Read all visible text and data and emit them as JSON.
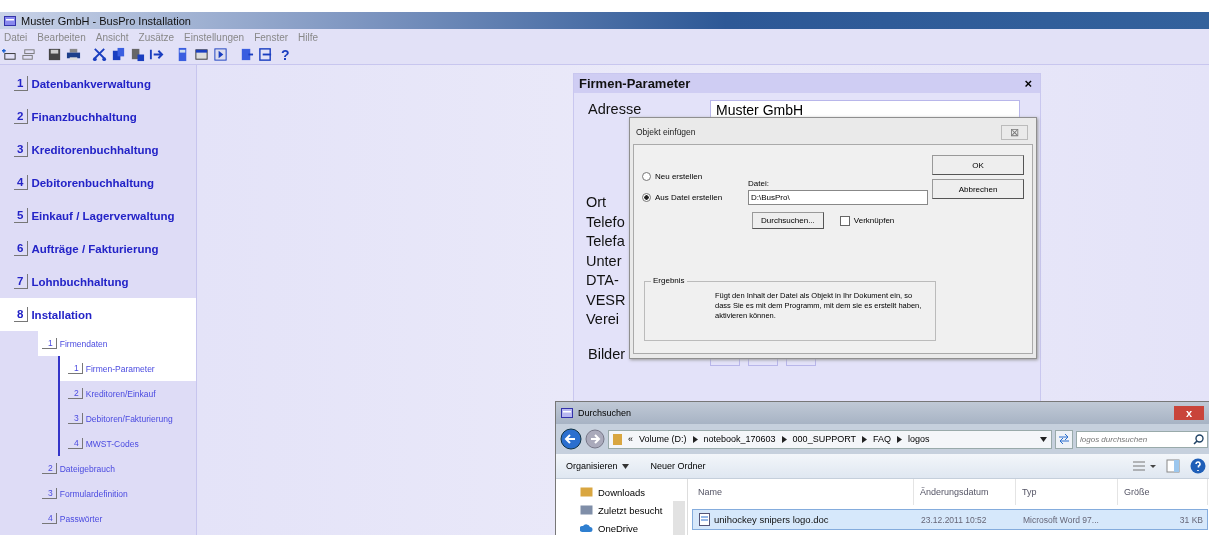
{
  "window": {
    "title": "Muster GmbH - BusPro Installation"
  },
  "menu": [
    "Datei",
    "Bearbeiten",
    "Ansicht",
    "Zusätze",
    "Einstellungen",
    "Fenster",
    "Hilfe"
  ],
  "toolbar": {
    "help": "?"
  },
  "sidebar": {
    "items": [
      {
        "number": "1",
        "label": "Datenbankverwaltung",
        "selected": false
      },
      {
        "number": "2",
        "label": "Finanzbuchhaltung",
        "selected": false
      },
      {
        "number": "3",
        "label": "Kreditorenbuchhaltung",
        "selected": false
      },
      {
        "number": "4",
        "label": "Debitorenbuchhaltung",
        "selected": false
      },
      {
        "number": "5",
        "label": "Einkauf / Lagerverwaltung",
        "selected": false
      },
      {
        "number": "6",
        "label": "Aufträge / Fakturierung",
        "selected": false
      },
      {
        "number": "7",
        "label": "Lohnbuchhaltung",
        "selected": false
      },
      {
        "number": "8",
        "label": "Installation",
        "selected": true,
        "children": [
          {
            "number": "1",
            "label": "Firmendaten",
            "selected": true,
            "children": [
              {
                "number": "1",
                "label": "Firmen-Parameter",
                "selected": true
              },
              {
                "number": "2",
                "label": "Kreditoren/Einkauf",
                "selected": false
              },
              {
                "number": "3",
                "label": "Debitoren/Fakturierung",
                "selected": false
              },
              {
                "number": "4",
                "label": "MWST-Codes",
                "selected": false
              }
            ]
          },
          {
            "number": "2",
            "label": "Dateigebrauch",
            "selected": false
          },
          {
            "number": "3",
            "label": "Formulardefinition",
            "selected": false
          },
          {
            "number": "4",
            "label": "Passwörter",
            "selected": false
          }
        ]
      }
    ]
  },
  "panel": {
    "title": "Firmen-Parameter",
    "close": "×",
    "address_label": "Adresse",
    "address_value": "Muster GmbH",
    "labels": [
      "Ort",
      "Telefo",
      "Telefa",
      "Unter",
      "DTA-",
      "VESR",
      "Verei"
    ],
    "images_label": "Bilder"
  },
  "dialog": {
    "title": "Objekt einfügen",
    "close": "⊠",
    "options": [
      {
        "label": "Neu erstellen",
        "selected": false
      },
      {
        "label": "Aus Datei erstellen",
        "selected": true
      }
    ],
    "file_label": "Datei:",
    "file_value": "D:\\BusPro\\",
    "browse": "Durchsuchen...",
    "link": {
      "label": "Verknüpfen",
      "checked": false
    },
    "ok": "OK",
    "cancel": "Abbrechen",
    "result_title": "Ergebnis",
    "result_text": "Fügt den Inhalt der Datei als Objekt in Ihr Dokument ein, so dass Sie es mit dem Programm, mit dem sie es erstellt haben, aktivieren können."
  },
  "browser": {
    "title": "Durchsuchen",
    "close": "x",
    "path_prefix": "«",
    "path": [
      "Volume (D:)",
      "notebook_170603",
      "000_SUPPORT",
      "FAQ",
      "logos"
    ],
    "search": {
      "placeholder": "logos durchsuchen"
    },
    "commands": [
      {
        "label": "Organisieren",
        "dropdown": true
      },
      {
        "label": "Neuer Ordner",
        "dropdown": false
      }
    ],
    "nav": [
      {
        "label": "Downloads",
        "kind": "folder"
      },
      {
        "label": "Zuletzt besucht",
        "kind": "recent"
      },
      {
        "label": "OneDrive",
        "kind": "cloud"
      }
    ],
    "columns": [
      "Name",
      "Änderungsdatum",
      "Typ",
      "Größe"
    ],
    "rows": [
      {
        "cells": [
          "unihockey snipers logo.doc",
          "23.12.2011 10:52",
          "Microsoft Word 97...",
          "31 KB"
        ],
        "selected": true
      }
    ]
  }
}
